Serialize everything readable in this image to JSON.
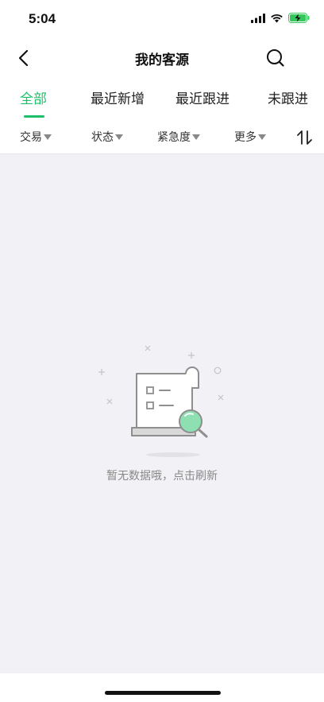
{
  "status_bar": {
    "time": "5:04"
  },
  "nav": {
    "title": "我的客源"
  },
  "tabs": [
    {
      "label": "全部",
      "active": true
    },
    {
      "label": "最近新增",
      "active": false
    },
    {
      "label": "最近跟进",
      "active": false
    },
    {
      "label": "未跟进",
      "active": false
    }
  ],
  "filters": [
    {
      "label": "交易"
    },
    {
      "label": "状态"
    },
    {
      "label": "紧急度"
    },
    {
      "label": "更多"
    }
  ],
  "empty_state": {
    "message": "暂无数据哦，点击刷新"
  },
  "colors": {
    "accent": "#1fbf6a",
    "background": "#f2f2f6",
    "battery": "#34c759"
  },
  "icons": [
    "back-arrow-icon",
    "search-icon",
    "sort-icon",
    "signal-icon",
    "wifi-icon",
    "battery-charging-icon"
  ]
}
